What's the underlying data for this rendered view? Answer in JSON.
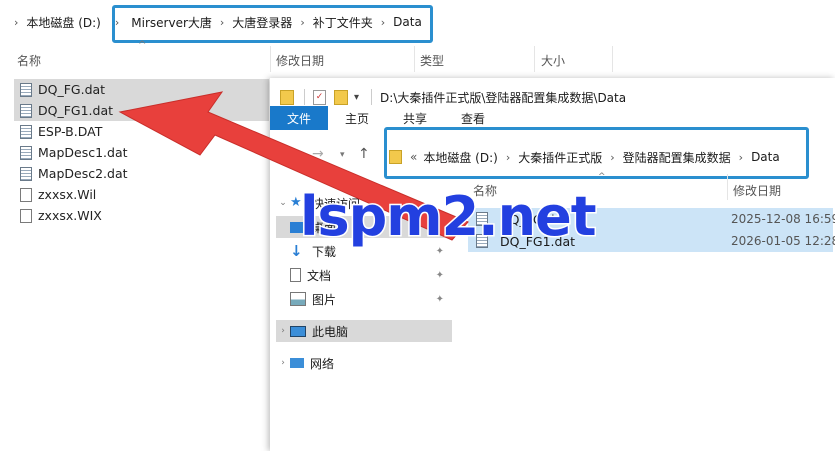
{
  "back_window": {
    "breadcrumb": [
      "本地磁盘 (D:)",
      "Mirserver大唐",
      "大唐登录器",
      "补丁文件夹",
      "Data"
    ],
    "columns": [
      "名称",
      "修改日期",
      "类型",
      "大小"
    ],
    "files": [
      {
        "name": "DQ_FG.dat",
        "icon": "dat-file-icon",
        "selected": true
      },
      {
        "name": "DQ_FG1.dat",
        "icon": "dat-file-icon",
        "selected": true
      },
      {
        "name": "ESP-B.DAT",
        "icon": "dat-file-icon",
        "selected": false
      },
      {
        "name": "MapDesc1.dat",
        "icon": "dat-file-icon",
        "selected": false
      },
      {
        "name": "MapDesc2.dat",
        "icon": "dat-file-icon",
        "selected": false
      },
      {
        "name": "zxxsx.Wil",
        "icon": "blank-file-icon",
        "selected": false
      },
      {
        "name": "zxxsx.WIX",
        "icon": "blank-file-icon",
        "selected": false
      }
    ]
  },
  "front_window": {
    "title_path": "D:\\大秦插件正式版\\登陆器配置集成数据\\Data",
    "ribbon_tabs": [
      "文件",
      "主页",
      "共享",
      "查看"
    ],
    "breadcrumb_prefix": "«",
    "breadcrumb": [
      "本地磁盘 (D:)",
      "大秦插件正式版",
      "登陆器配置集成数据",
      "Data"
    ],
    "columns": [
      "名称",
      "修改日期"
    ],
    "nav": {
      "quick_access": "快速访问",
      "items": [
        "桌面",
        "下载",
        "文档",
        "图片"
      ],
      "this_pc": "此电脑",
      "network": "网络"
    },
    "files": [
      {
        "name": "DQ_FG.dat",
        "date": "2025-12-08 16:59"
      },
      {
        "name": "DQ_FG1.dat",
        "date": "2026-01-05 12:28"
      }
    ]
  },
  "watermark": "lspm2.net",
  "colors": {
    "highlight_box": "#2a8fcf",
    "arrow": "#e8403c",
    "ribbon_active": "#1979ca",
    "selection": "#cce4f7"
  }
}
